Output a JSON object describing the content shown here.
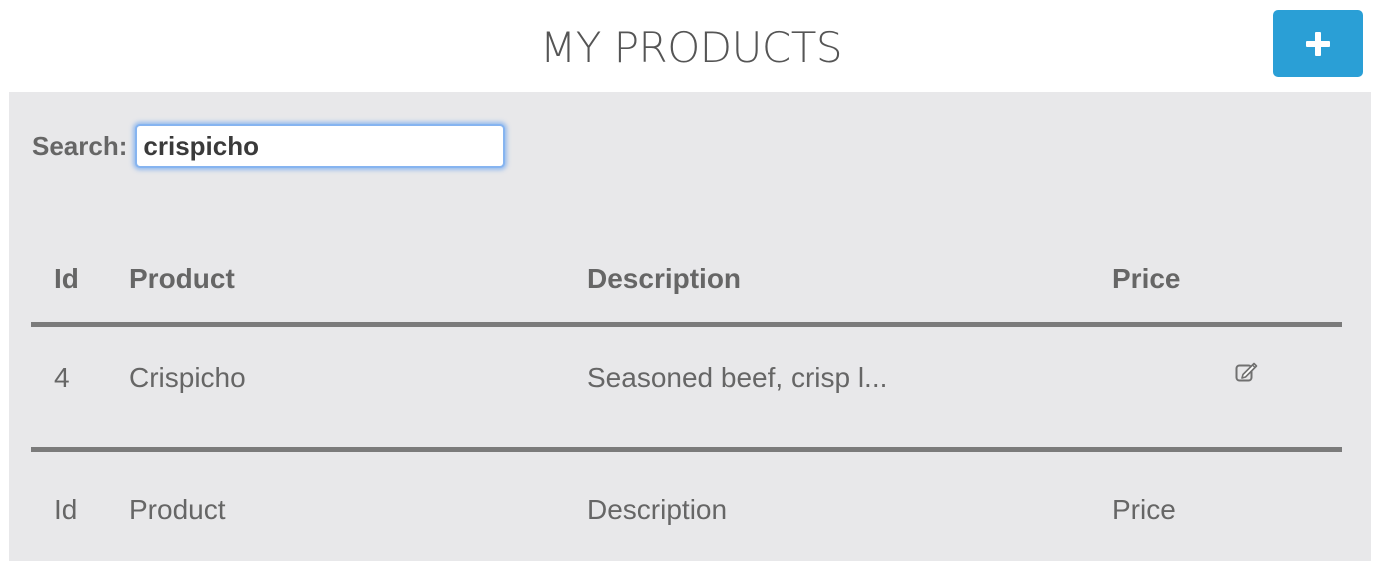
{
  "header": {
    "title": "MY PRODUCTS",
    "add_button_icon": "plus-icon",
    "accent_color": "#2a9fd6"
  },
  "search": {
    "label": "Search:",
    "value": "crispicho"
  },
  "table": {
    "columns": [
      "Id",
      "Product",
      "Description",
      "Price"
    ],
    "rows": [
      {
        "id": "4",
        "product": "Crispicho",
        "description": "Seasoned beef, crisp l...",
        "price": "",
        "action_icon": "edit-icon"
      }
    ],
    "footer_columns": [
      "Id",
      "Product",
      "Description",
      "Price"
    ]
  }
}
